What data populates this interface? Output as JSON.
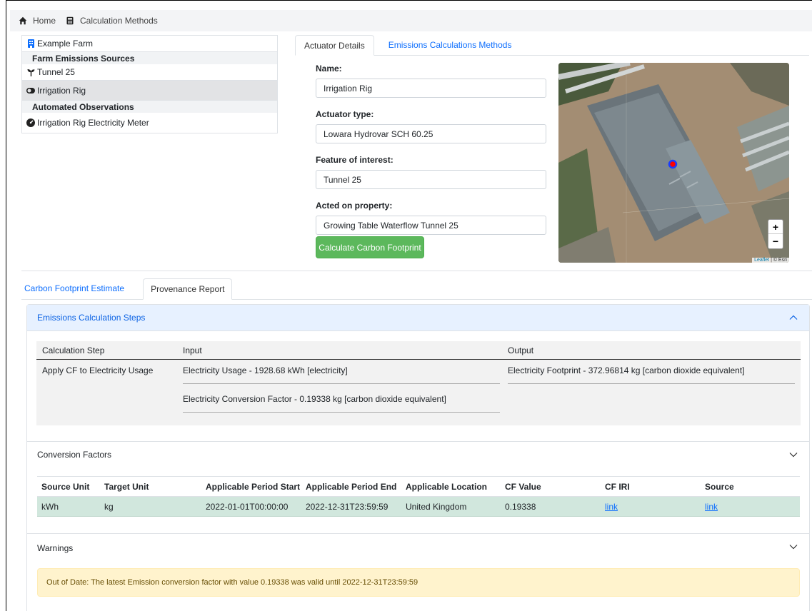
{
  "breadcrumb": {
    "home_label": "Home",
    "calc_label": "Calculation Methods"
  },
  "tree": {
    "farm": "Example Farm",
    "sources_header": "Farm Emissions Sources",
    "sources": [
      {
        "label": "Tunnel 25",
        "icon": "seedling-icon"
      },
      {
        "label": "Irrigation Rig",
        "icon": "toggle-icon"
      }
    ],
    "observations_header": "Automated Observations",
    "observations": [
      {
        "label": "Irrigation Rig Electricity Meter",
        "icon": "gauge-icon"
      }
    ]
  },
  "top_tabs": {
    "actuator": "Actuator Details",
    "methods": "Emissions Calculations Methods"
  },
  "form": {
    "name_label": "Name:",
    "name_value": "Irrigation Rig",
    "type_label": "Actuator type:",
    "type_value": "Lowara Hydrovar SCH 60.25",
    "feature_label": "Feature of interest:",
    "feature_value": "Tunnel 25",
    "property_label": "Acted on property:",
    "property_value": "Growing Table Waterflow Tunnel 25",
    "calc_button": "Calculate Carbon Footprint"
  },
  "map": {
    "zoom_in": "+",
    "zoom_out": "−",
    "attr_leaflet": "Leaflet",
    "attr_rest": " | © Esri"
  },
  "bottom_tabs": {
    "estimate": "Carbon Footprint Estimate",
    "provenance": "Provenance Report"
  },
  "steps": {
    "title": "Emissions Calculation Steps",
    "col_step": "Calculation Step",
    "col_input": "Input",
    "col_output": "Output",
    "step": "Apply CF to Electricity Usage",
    "input1": "Electricity Usage - 1928.68 kWh [electricity]",
    "input2": "Electricity Conversion Factor - 0.19338 kg [carbon dioxide equivalent]",
    "output1": "Electricity Footprint - 372.96814 kg [carbon dioxide equivalent]"
  },
  "conversion": {
    "title": "Conversion Factors",
    "headers": [
      "Source Unit",
      "Target Unit",
      "Applicable Period Start",
      "Applicable Period End",
      "Applicable Location",
      "CF Value",
      "CF IRI",
      "Source"
    ],
    "row": [
      "kWh",
      "kg",
      "2022-01-01T00:00:00",
      "2022-12-31T23:59:59",
      "United Kingdom",
      "0.19338",
      "link",
      "link"
    ]
  },
  "warnings": {
    "title": "Warnings",
    "message": "Out of Date: The latest Emission conversion factor with value 0.19338 was valid until 2022-12-31T23:59:59"
  },
  "colors": {
    "accent": "#0d6efd",
    "button_green": "#5cb85c",
    "row_success": "#d1e7dd",
    "warning_bg": "#fff3cd"
  }
}
